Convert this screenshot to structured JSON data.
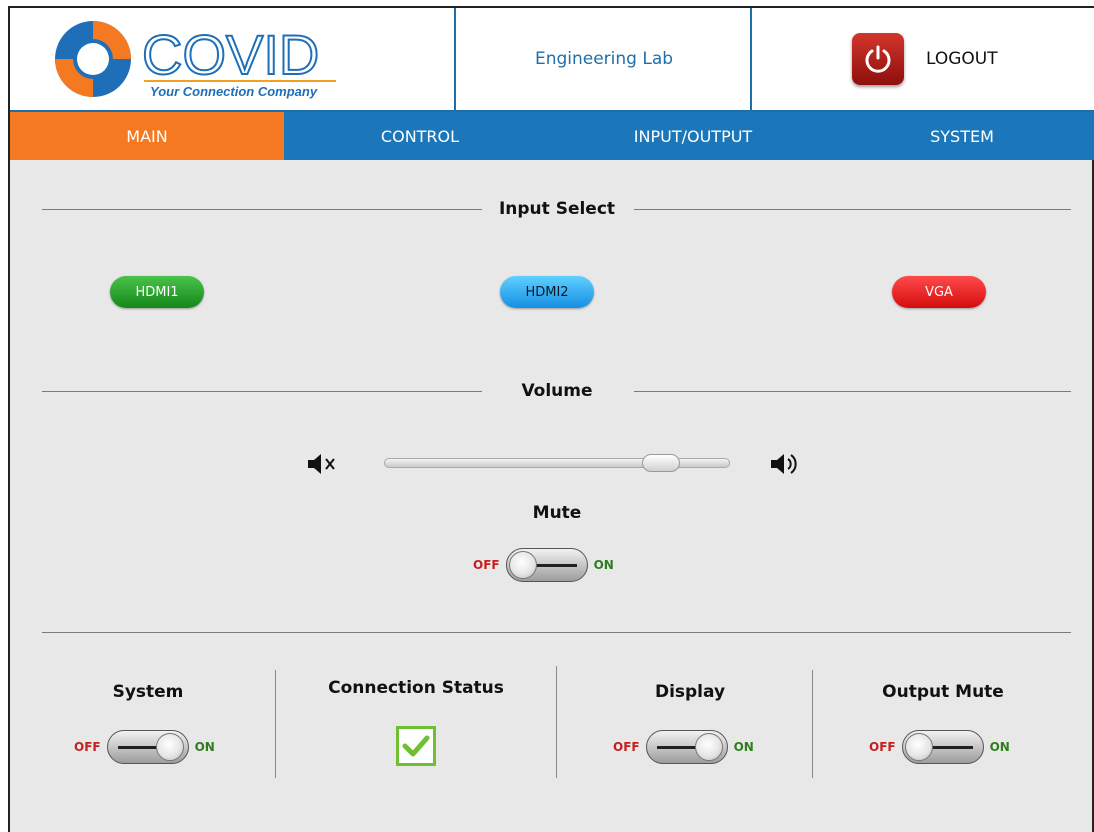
{
  "header": {
    "logo": {
      "name": "COVID",
      "tagline": "Your Connection Company"
    },
    "room": "Engineering Lab",
    "logout_label": "LOGOUT"
  },
  "nav": {
    "tabs": [
      {
        "label": "MAIN",
        "active": true
      },
      {
        "label": "CONTROL",
        "active": false
      },
      {
        "label": "INPUT/OUTPUT",
        "active": false
      },
      {
        "label": "SYSTEM",
        "active": false
      }
    ]
  },
  "input_select": {
    "title": "Input Select",
    "buttons": [
      {
        "label": "HDMI1",
        "color": "#1f9a25"
      },
      {
        "label": "HDMI2",
        "color": "#2aa7f0"
      },
      {
        "label": "VGA",
        "color": "#e81c1c"
      }
    ]
  },
  "volume": {
    "title": "Volume",
    "level_fraction": 0.84,
    "mute_icon": "speaker-mute-icon",
    "loud_icon": "speaker-loud-icon"
  },
  "mute": {
    "title": "Mute",
    "off_label": "OFF",
    "on_label": "ON",
    "state": "off"
  },
  "status": {
    "system": {
      "title": "System",
      "off_label": "OFF",
      "on_label": "ON",
      "state": "on"
    },
    "connection": {
      "title": "Connection Status",
      "connected": true
    },
    "display": {
      "title": "Display",
      "off_label": "OFF",
      "on_label": "ON",
      "state": "on"
    },
    "output_mute": {
      "title": "Output Mute",
      "off_label": "OFF",
      "on_label": "ON",
      "state": "off"
    }
  },
  "colors": {
    "brand_blue": "#1b77b9",
    "active_tab": "#f47920",
    "off_red": "#c42020",
    "on_green": "#2e7d1f"
  }
}
